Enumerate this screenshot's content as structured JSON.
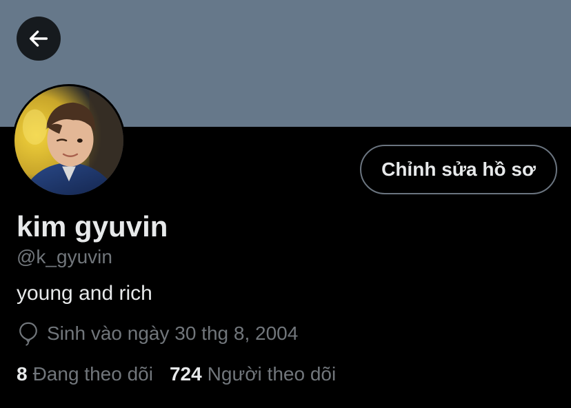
{
  "colors": {
    "banner": "#66788a",
    "background": "#000000",
    "text_primary": "#e7e9ea",
    "text_secondary": "#71767b",
    "button_border": "#6b7580"
  },
  "header": {
    "back_icon": "arrow-left-icon"
  },
  "profile": {
    "avatar_icon": "avatar-photo",
    "edit_button_label": "Chỉnh sửa hồ sơ",
    "display_name": "kim gyuvin",
    "handle": "@k_gyuvin",
    "bio": "young and rich",
    "birthday_icon": "balloon-icon",
    "birthday": "Sinh vào ngày 30 thg 8, 2004"
  },
  "stats": {
    "following_count": "8",
    "following_label": "Đang theo dõi",
    "followers_count": "724",
    "followers_label": "Người theo dõi"
  }
}
